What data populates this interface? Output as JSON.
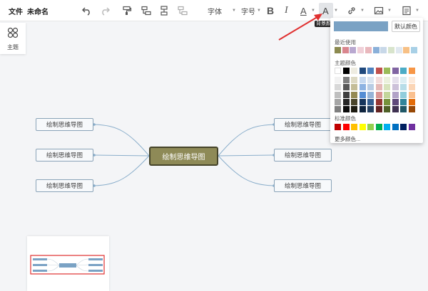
{
  "menu": {
    "file": "文件",
    "doc_name": "未命名"
  },
  "toolbar": {
    "font_label": "字体",
    "size_label": "字号",
    "bold": "B",
    "italic": "I",
    "font_color": "A",
    "bg_color": "A",
    "bg_color_tooltip": "背景颜色"
  },
  "sidebar": {
    "theme_label": "主题"
  },
  "mindmap": {
    "root": "绘制思维导图",
    "left": [
      "绘制思维导图",
      "绘制思维导图",
      "绘制思维导图"
    ],
    "right": [
      "绘制思维导图",
      "绘制思维导图",
      "绘制思维导图"
    ]
  },
  "color_popup": {
    "default_button": "默认颜色",
    "recent_label": "最近使用",
    "theme_label": "主题颜色",
    "standard_label": "标准颜色",
    "more_label": "更多颜色...",
    "preview_color": "#7aa2c4",
    "recent_colors": [
      "#8c8a50",
      "#d9868e",
      "#b9a8d0",
      "#f0d0d8",
      "#e9b8bd",
      "#8ab0d9",
      "#c8d8e8",
      "#d8e4cc",
      "#e0e8f0",
      "#f7c085",
      "#a8d0e6"
    ],
    "theme_columns": [
      [
        "#ffffff",
        "#f2f2f2",
        "#d8d8d8",
        "#bfbfbf",
        "#a5a5a5",
        "#7f7f7f"
      ],
      [
        "#000000",
        "#7f7f7f",
        "#595959",
        "#3f3f3f",
        "#262626",
        "#0c0c0c"
      ],
      [
        "#eeece1",
        "#ddd9c3",
        "#c4bd97",
        "#948a54",
        "#4a452a",
        "#1d1b10"
      ],
      [
        "#1f497d",
        "#c6d9f0",
        "#8db3e2",
        "#548dd4",
        "#17365d",
        "#0f243e"
      ],
      [
        "#4f81bd",
        "#dbe5f1",
        "#b8cce4",
        "#95b3d7",
        "#366092",
        "#244061"
      ],
      [
        "#c0504d",
        "#f2dcdb",
        "#e5b9b7",
        "#d99694",
        "#953734",
        "#632423"
      ],
      [
        "#9bbb59",
        "#ebf1dd",
        "#d7e3bc",
        "#c3d69b",
        "#76923c",
        "#4f6128"
      ],
      [
        "#8064a2",
        "#e5e0ec",
        "#ccc1d9",
        "#b2a2c7",
        "#5f497a",
        "#3f3151"
      ],
      [
        "#4bacc6",
        "#dbeef3",
        "#b7dde8",
        "#92cddc",
        "#31859b",
        "#205867"
      ],
      [
        "#f79646",
        "#fdeada",
        "#fbd5b5",
        "#fac08f",
        "#e36c09",
        "#974806"
      ]
    ],
    "standard_colors": [
      "#c00000",
      "#ff0000",
      "#ffc000",
      "#ffff00",
      "#92d050",
      "#00b050",
      "#00b0f0",
      "#0070c0",
      "#002060",
      "#7030a0"
    ]
  },
  "colors": {
    "root_fill": "#8e8a57",
    "root_border": "#45442a",
    "node_border": "#8aa3b8",
    "link": "#8aaecb",
    "arrow": "#e03030"
  }
}
